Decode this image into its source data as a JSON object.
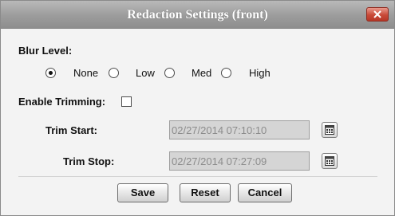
{
  "dialog": {
    "title": "Redaction Settings (front)",
    "close_icon": "close-x-icon"
  },
  "blur": {
    "label": "Blur Level:",
    "options": [
      {
        "label": "None",
        "selected": true
      },
      {
        "label": "Low",
        "selected": false
      },
      {
        "label": "Med",
        "selected": false
      },
      {
        "label": "High",
        "selected": false
      }
    ]
  },
  "trimming": {
    "label": "Enable Trimming:",
    "checked": false
  },
  "trim_start": {
    "label": "Trim Start:",
    "value": "02/27/2014 07:10:10",
    "calendar_icon": "calendar-icon"
  },
  "trim_stop": {
    "label": "Trim Stop:",
    "value": "02/27/2014 07:27:09",
    "calendar_icon": "calendar-icon"
  },
  "buttons": {
    "save": "Save",
    "reset": "Reset",
    "cancel": "Cancel"
  },
  "colors": {
    "titlebar": "#9c9c9c",
    "close_button": "#c94a38",
    "dialog_background": "#f3f3f3",
    "disabled_field": "#d5d5d5"
  }
}
